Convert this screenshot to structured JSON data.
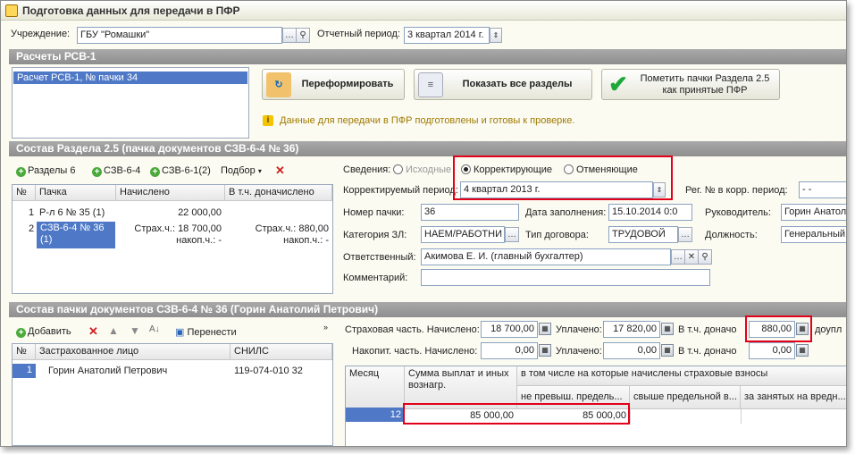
{
  "window": {
    "title": "Подготовка данных для передачи в ПФР"
  },
  "header": {
    "institution_label": "Учреждение:",
    "institution_value": "ГБУ \"Ромашки\"",
    "period_label": "Отчетный период:",
    "period_value": "3 квартал 2014 г."
  },
  "rsv": {
    "band": "Расчеты РСВ-1",
    "list_item": "Расчет РСВ-1, № пачки 34",
    "btn_reform": "Переформировать",
    "btn_show_all": "Показать все разделы",
    "btn_mark_line1": "Пометить пачки Раздела 2.5",
    "btn_mark_line2": "как принятые ПФР",
    "info": "Данные для передачи в ПФР подготовлены и готовы к проверке."
  },
  "section25": {
    "band": "Состав Раздела 2.5     (пачка документов СЗВ-6-4 № 36)",
    "toolbar": {
      "sections": "Разделы 6",
      "szv64": "СЗВ-6-4",
      "szv612": "СЗВ-6-1(2)",
      "selection": "Подбор"
    },
    "columns": {
      "num": "№",
      "pack": "Пачка",
      "accrued": "Начислено",
      "extra": "В т.ч. доначислено"
    },
    "rows": [
      {
        "num": "1",
        "pack": "Р-л 6 № 35 (1)",
        "accrued": "22 000,00",
        "extra": ""
      },
      {
        "num": "2",
        "pack": "СЗВ-6-4 № 36",
        "pack2": "(1)",
        "accrued": "Страх.ч.: 18 700,00",
        "accrued2": "накоп.ч.: -",
        "extra": "Страх.ч.: 880,00",
        "extra2": "накоп.ч.: -"
      }
    ],
    "form": {
      "info_label": "Сведения:",
      "radio_source": "Исходные",
      "radio_correct": "Корректирующие",
      "radio_cancel": "Отменяющие",
      "corr_period_label": "Корректируемый период:",
      "corr_period_value": "4 квартал 2013 г.",
      "reg_label": "Рег. № в корр. период:",
      "reg_value": "-  -",
      "pack_num_label": "Номер пачки:",
      "pack_num_value": "36",
      "fill_date_label": "Дата заполнения:",
      "fill_date_value": "15.10.2014  0:0",
      "head_label": "Руководитель:",
      "head_value": "Горин Анатол",
      "category_label": "Категория ЗЛ:",
      "category_value": "НАЕМ/РАБОТНИ",
      "contract_label": "Тип договора:",
      "contract_value": "ТРУДОВОЙ",
      "position_label": "Должность:",
      "position_value": "Генеральный",
      "responsible_label": "Ответственный:",
      "responsible_value": "Акимова Е. И. (главный бухгалтер)",
      "comment_label": "Комментарий:",
      "comment_value": ""
    }
  },
  "pack": {
    "band": "Состав пачки документов СЗВ-6-4 № 36        (Горин Анатолий Петрович)",
    "toolbar": {
      "add": "Добавить",
      "move": "Перенести"
    },
    "columns": {
      "num": "№",
      "person": "Застрахованное лицо",
      "snils": "СНИЛС"
    },
    "rows": [
      {
        "num": "1",
        "person": "Горин Анатолий Петрович",
        "snils": "119-074-010 32"
      }
    ],
    "ins_label": "Страховая часть. Начислено:",
    "ins_accrued": "18 700,00",
    "paid_label": "Уплачено:",
    "ins_paid": "17 820,00",
    "extra_label": "В т.ч. доначо",
    "ins_extra": "880,00",
    "extra_trail": "доупл",
    "acc_label": "Накопит. часть. Начислено:",
    "acc_accrued": "0,00",
    "acc_paid": "0,00",
    "acc_extra": "0,00",
    "grid": {
      "col_month": "Месяц",
      "col_sum": "Сумма выплат и иных вознагр.",
      "col_group": "в том числе на которые начислены страховые взносы",
      "col_not_exceed": "не превыш. предель...",
      "col_over": "свыше предельной в...",
      "col_harmful": "за занятых на вредн...",
      "row_month": "12",
      "row_sum": "85 000,00",
      "row_not_exceed": "85 000,00"
    }
  }
}
